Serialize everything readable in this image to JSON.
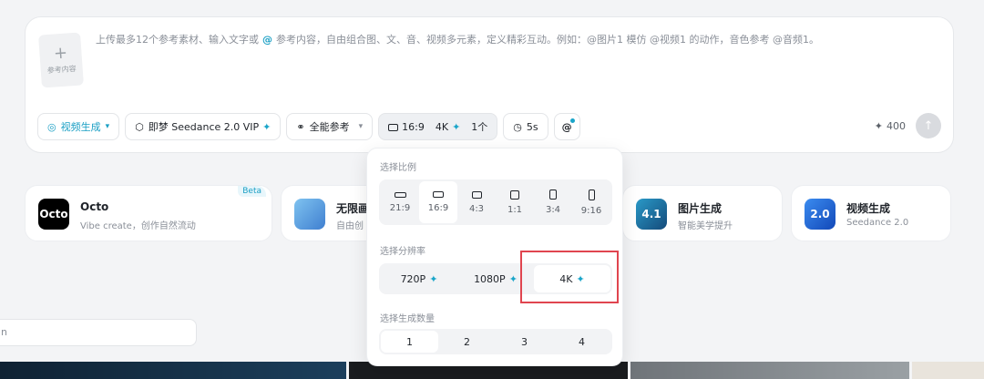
{
  "composer": {
    "upload_label": "参考内容",
    "prompt_prefix": "上传最多12个参考素材、输入文字或",
    "prompt_at": "@",
    "prompt_suffix": "参考内容，自由组合图、文、音、视频多元素，定义精彩互动。例如：@图片1 模仿 @视频1 的动作，音色参考 @音频1。"
  },
  "toolbar": {
    "mode": "视频生成",
    "model": "即梦 Seedance 2.0 VIP",
    "reference": "全能参考",
    "ratio": "16:9",
    "resolution": "4K",
    "count": "1个",
    "duration": "5s",
    "at": "@",
    "credits": "400"
  },
  "cards": [
    {
      "title": "Octo",
      "sub": "Vibe create，创作自然流动",
      "badge": "Beta",
      "logo": "Octo",
      "color": "#000000"
    },
    {
      "title": "无限画",
      "sub": "自由创",
      "logo": "",
      "color": "#4a8fd8"
    },
    {
      "title": "图片生成",
      "sub": "智能美学提升",
      "logo": "4.1",
      "color": "#1e6fa8"
    },
    {
      "title": "视频生成",
      "sub": "Seedance 2.0",
      "logo": "2.0",
      "color": "#1a5fd0"
    }
  ],
  "search_fragment": "n",
  "popover": {
    "ratio_title": "选择比例",
    "ratios": [
      "21:9",
      "16:9",
      "4:3",
      "1:1",
      "3:4",
      "9:16"
    ],
    "ratio_selected": "16:9",
    "res_title": "选择分辨率",
    "resolutions": [
      "720P",
      "1080P",
      "4K"
    ],
    "res_selected": "4K",
    "count_title": "选择生成数量",
    "counts": [
      "1",
      "2",
      "3",
      "4"
    ],
    "count_selected": "1"
  },
  "colors": {
    "accent": "#1a9fc4",
    "highlight": "#e0454f"
  }
}
